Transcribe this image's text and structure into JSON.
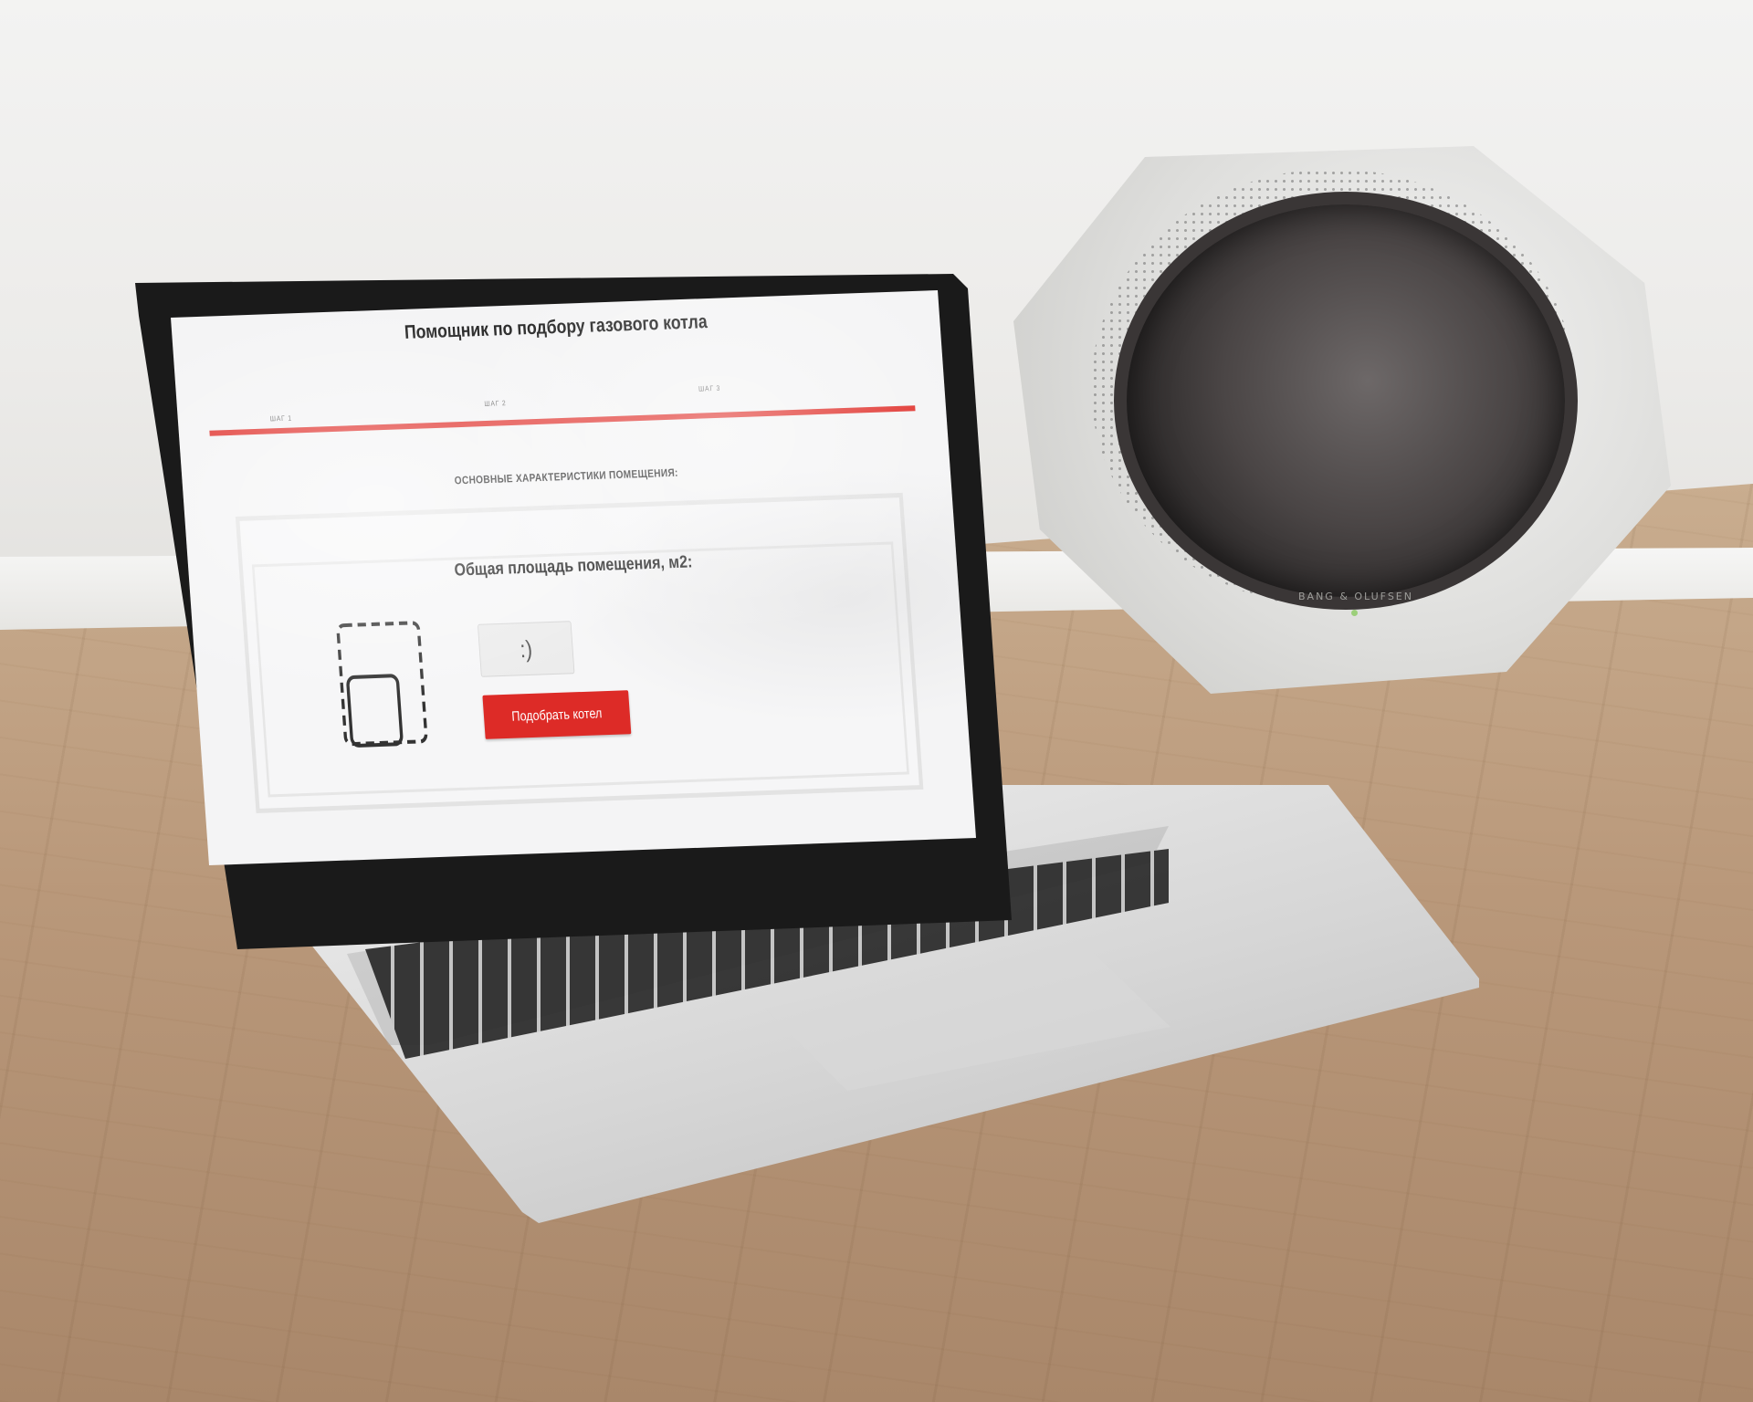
{
  "page": {
    "title": "Помощник по подбору газового котла"
  },
  "steps": {
    "items": [
      "ШАГ 1",
      "ШАГ 2",
      "ШАГ 3"
    ],
    "progress_percent": 100,
    "accent_color": "#e0302b"
  },
  "section": {
    "heading": "ОСНОВНЫЕ ХАРАКТЕРИСТИКИ ПОМЕЩЕНИЯ:"
  },
  "area_card": {
    "title": "Общая площадь помещения, м2:",
    "icon": "room-area-icon",
    "input_value": ":)",
    "submit_label": "Подобрать котел",
    "button_color": "#dd2b27"
  },
  "speaker": {
    "brand": "BANG & OLUFSEN"
  }
}
